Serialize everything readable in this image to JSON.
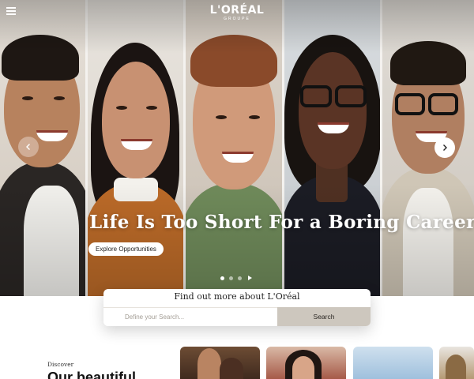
{
  "header": {
    "menu_icon": "hamburger-menu-icon",
    "logo": {
      "brand": "L'ORÉAL",
      "sub": "GROUPE"
    }
  },
  "hero": {
    "headline": "Life Is Too Short For a Boring Career",
    "cta_label": "Explore Opportunities",
    "prev_icon": "chevron-left-icon",
    "next_icon": "chevron-right-icon",
    "slides_total": 3,
    "slide_active": 1,
    "play_icon": "play-icon"
  },
  "search": {
    "title": "Find out more about L'Oréal",
    "placeholder": "Define your Search...",
    "button_label": "Search"
  },
  "discover": {
    "eyebrow": "Discover",
    "title": "Our beautiful"
  },
  "colors": {
    "accent_button": "#cdc7be",
    "hero_text": "#ffffff"
  }
}
